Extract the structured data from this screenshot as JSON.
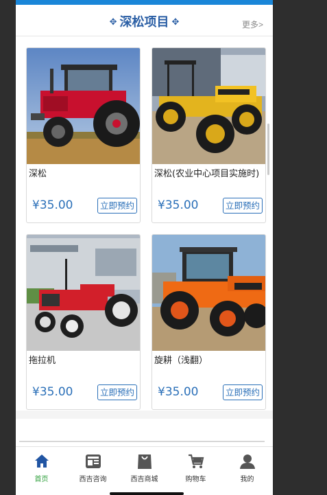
{
  "section": {
    "title": "深松项目",
    "more": "更多>"
  },
  "products": [
    {
      "title": "深松",
      "price": "¥35.00",
      "book": "立即预约",
      "image": "red-tractor-field"
    },
    {
      "title": "深松(农业中心项目实施时)",
      "price": "¥35.00",
      "book": "立即预约",
      "image": "yellow-tractor"
    },
    {
      "title": "拖拉机",
      "price": "¥35.00",
      "book": "立即预约",
      "image": "red-small-tractor"
    },
    {
      "title": "旋耕（浅翻）",
      "price": "¥35.00",
      "book": "立即预约",
      "image": "orange-tractor"
    }
  ],
  "nav": {
    "items": [
      {
        "label": "首页",
        "icon": "home-icon",
        "active": true
      },
      {
        "label": "西吉咨询",
        "icon": "news-icon",
        "active": false
      },
      {
        "label": "西吉商城",
        "icon": "shopping-bag-icon",
        "active": false
      },
      {
        "label": "购物车",
        "icon": "cart-icon",
        "active": false
      },
      {
        "label": "我的",
        "icon": "user-icon",
        "active": false
      }
    ]
  },
  "colors": {
    "accent": "#1a86d8",
    "title": "#2b5fa5",
    "price": "#2a6fb8",
    "active_nav": "#2e9f3b"
  }
}
